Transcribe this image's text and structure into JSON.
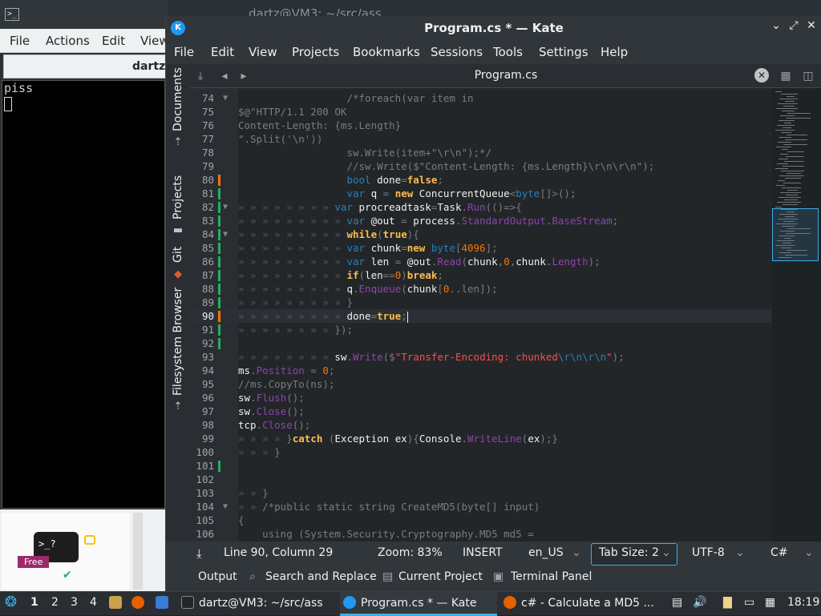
{
  "terminal": {
    "title": "dartz@VM3: ~/src/ass",
    "menu": [
      "File",
      "Actions",
      "Edit",
      "View"
    ],
    "tab_label": "dartz",
    "output": "piss",
    "thumb_prompt": ">_?",
    "thumb_badge": "Free"
  },
  "kate": {
    "title": "Program.cs * — Kate",
    "menu": [
      "File",
      "Edit",
      "View",
      "Projects",
      "Bookmarks",
      "Sessions",
      "Tools",
      "Settings",
      "Help"
    ],
    "sidebar_tabs": [
      "Documents",
      "Projects",
      "Git",
      "Filesystem Browser"
    ],
    "tab_name": "Program.cs",
    "lines": [
      {
        "n": "74",
        "fold": "v",
        "code": [
          [
            "ws",
            "                  "
          ],
          [
            "c",
            "/*foreach(var item in"
          ]
        ]
      },
      {
        "n": "75",
        "code": [
          [
            "c",
            "$@\"HTTP/1.1 200 OK"
          ]
        ]
      },
      {
        "n": "76",
        "code": [
          [
            "c",
            "Content-Length: {ms.Length}"
          ]
        ]
      },
      {
        "n": "77",
        "code": [
          [
            "c",
            "\".Split('\\n'))"
          ]
        ]
      },
      {
        "n": "78",
        "code": [
          [
            "ws",
            "                  "
          ],
          [
            "c",
            "sw.Write(item+\"\\r\\n\");*/"
          ]
        ]
      },
      {
        "n": "79",
        "code": [
          [
            "ws",
            "                  "
          ],
          [
            "c",
            "//sw.Write($\"Content-Length: {ms.Length}\\r\\n\\r\\n\");"
          ]
        ]
      },
      {
        "n": "80",
        "mark": "#f67400",
        "code": [
          [
            "ws",
            "                  "
          ],
          [
            "t",
            "bool"
          ],
          [
            "p",
            " done"
          ],
          [
            "c",
            "="
          ],
          [
            "k",
            "false"
          ],
          [
            "c",
            ";"
          ]
        ]
      },
      {
        "n": "81",
        "mark": "#27ae60",
        "code": [
          [
            "ws",
            "                  "
          ],
          [
            "t",
            "var"
          ],
          [
            "p",
            " q "
          ],
          [
            "c",
            "="
          ],
          [
            "p",
            " "
          ],
          [
            "k",
            "new"
          ],
          [
            "p",
            " ConcurrentQueue"
          ],
          [
            "c",
            "<"
          ],
          [
            "t",
            "byte"
          ],
          [
            "c",
            "[]>();"
          ]
        ]
      },
      {
        "n": "82",
        "fold": "v",
        "mark": "#27ae60",
        "code": [
          [
            "ws",
            "» » » » » » » » "
          ],
          [
            "t",
            "var"
          ],
          [
            "p",
            " procreadtask"
          ],
          [
            "c",
            "="
          ],
          [
            "p",
            "Task"
          ],
          [
            "c",
            "."
          ],
          [
            "f",
            "Run"
          ],
          [
            "c",
            "(()=>{"
          ]
        ]
      },
      {
        "n": "83",
        "mark": "#27ae60",
        "code": [
          [
            "ws",
            "» » » » » » » » » "
          ],
          [
            "t",
            "var"
          ],
          [
            "p",
            " @out "
          ],
          [
            "c",
            "="
          ],
          [
            "p",
            " process"
          ],
          [
            "c",
            "."
          ],
          [
            "f",
            "StandardOutput"
          ],
          [
            "c",
            "."
          ],
          [
            "f",
            "BaseStream"
          ],
          [
            "c",
            ";"
          ]
        ]
      },
      {
        "n": "84",
        "fold": "v",
        "mark": "#27ae60",
        "code": [
          [
            "ws",
            "» » » » » » » » » "
          ],
          [
            "k",
            "while"
          ],
          [
            "c",
            "("
          ],
          [
            "k",
            "true"
          ],
          [
            "c",
            "){"
          ]
        ]
      },
      {
        "n": "85",
        "mark": "#27ae60",
        "code": [
          [
            "ws",
            "» » » » » » » » » "
          ],
          [
            "t",
            "var"
          ],
          [
            "p",
            " chunk"
          ],
          [
            "c",
            "="
          ],
          [
            "k",
            "new"
          ],
          [
            "p",
            " "
          ],
          [
            "t",
            "byte"
          ],
          [
            "c",
            "["
          ],
          [
            "n",
            "4096"
          ],
          [
            "c",
            "];"
          ]
        ]
      },
      {
        "n": "86",
        "mark": "#27ae60",
        "code": [
          [
            "ws",
            "» » » » » » » » » "
          ],
          [
            "t",
            "var"
          ],
          [
            "p",
            " len "
          ],
          [
            "c",
            "="
          ],
          [
            "p",
            " @out"
          ],
          [
            "c",
            "."
          ],
          [
            "f",
            "Read"
          ],
          [
            "c",
            "("
          ],
          [
            "p",
            "chunk"
          ],
          [
            "c",
            ","
          ],
          [
            "n",
            "0"
          ],
          [
            "c",
            ","
          ],
          [
            "p",
            "chunk"
          ],
          [
            "c",
            "."
          ],
          [
            "f",
            "Length"
          ],
          [
            "c",
            ");"
          ]
        ]
      },
      {
        "n": "87",
        "mark": "#27ae60",
        "code": [
          [
            "ws",
            "» » » » » » » » » "
          ],
          [
            "k",
            "if"
          ],
          [
            "c",
            "("
          ],
          [
            "p",
            "len"
          ],
          [
            "c",
            "=="
          ],
          [
            "n",
            "0"
          ],
          [
            "c",
            ")"
          ],
          [
            "k",
            "break"
          ],
          [
            "c",
            ";"
          ]
        ]
      },
      {
        "n": "88",
        "mark": "#27ae60",
        "code": [
          [
            "ws",
            "» » » » » » » » » "
          ],
          [
            "p",
            "q"
          ],
          [
            "c",
            "."
          ],
          [
            "f",
            "Enqueue"
          ],
          [
            "c",
            "("
          ],
          [
            "p",
            "chunk"
          ],
          [
            "c",
            "["
          ],
          [
            "n",
            "0"
          ],
          [
            "c",
            "..len]);"
          ]
        ]
      },
      {
        "n": "89",
        "mark": "#27ae60",
        "code": [
          [
            "ws",
            "» » » » » » » » » "
          ],
          [
            "c",
            "}"
          ]
        ]
      },
      {
        "n": "90",
        "mark": "#f67400",
        "cur": true,
        "code": [
          [
            "ws",
            "» » » » » » » » » "
          ],
          [
            "p",
            "done"
          ],
          [
            "c",
            "="
          ],
          [
            "k",
            "true"
          ],
          [
            "c",
            ";"
          ]
        ]
      },
      {
        "n": "91",
        "mark": "#27ae60",
        "code": [
          [
            "ws",
            "» » » » » » » » "
          ],
          [
            "c",
            "});"
          ]
        ]
      },
      {
        "n": "92",
        "mark": "#27ae60",
        "code": []
      },
      {
        "n": "93",
        "code": [
          [
            "ws",
            "» » » » » » » » "
          ],
          [
            "p",
            "sw"
          ],
          [
            "c",
            "."
          ],
          [
            "f",
            "Write"
          ],
          [
            "c",
            "($"
          ],
          [
            "s",
            "\"Transfer-Encoding: chunked"
          ],
          [
            "t",
            "\\r\\n\\r\\n"
          ],
          [
            "s",
            "\""
          ],
          [
            "c",
            ");"
          ]
        ]
      },
      {
        "n": "94",
        "code": [
          [
            "p",
            "ms"
          ],
          [
            "c",
            "."
          ],
          [
            "f",
            "Position"
          ],
          [
            "c",
            " = "
          ],
          [
            "n",
            "0"
          ],
          [
            "c",
            ";"
          ]
        ]
      },
      {
        "n": "95",
        "code": [
          [
            "c",
            "//ms.CopyTo(ns);"
          ]
        ]
      },
      {
        "n": "96",
        "code": [
          [
            "p",
            "sw"
          ],
          [
            "c",
            "."
          ],
          [
            "f",
            "Flush"
          ],
          [
            "c",
            "();"
          ]
        ]
      },
      {
        "n": "97",
        "code": [
          [
            "p",
            "sw"
          ],
          [
            "c",
            "."
          ],
          [
            "f",
            "Close"
          ],
          [
            "c",
            "();"
          ]
        ]
      },
      {
        "n": "98",
        "code": [
          [
            "p",
            "tcp"
          ],
          [
            "c",
            "."
          ],
          [
            "f",
            "Close"
          ],
          [
            "c",
            "();"
          ]
        ]
      },
      {
        "n": "99",
        "code": [
          [
            "ws",
            "» » » » "
          ],
          [
            "c",
            "}"
          ],
          [
            "k",
            "catch"
          ],
          [
            "p",
            " "
          ],
          [
            "c",
            "("
          ],
          [
            "p",
            "Exception ex"
          ],
          [
            "c",
            "){"
          ],
          [
            "p",
            "Console"
          ],
          [
            "c",
            "."
          ],
          [
            "f",
            "WriteLine"
          ],
          [
            "c",
            "("
          ],
          [
            "p",
            "ex"
          ],
          [
            "c",
            ");}"
          ]
        ]
      },
      {
        "n": "100",
        "code": [
          [
            "ws",
            "» » » "
          ],
          [
            "c",
            "}"
          ]
        ]
      },
      {
        "n": "101",
        "mark": "#27ae60",
        "code": []
      },
      {
        "n": "102",
        "code": []
      },
      {
        "n": "103",
        "code": [
          [
            "ws",
            "» » "
          ],
          [
            "c",
            "}"
          ]
        ]
      },
      {
        "n": "104",
        "fold": "v",
        "code": [
          [
            "ws",
            "» » "
          ],
          [
            "c",
            "/*public static string CreateMD5(byte[] input)"
          ]
        ]
      },
      {
        "n": "105",
        "code": [
          [
            "c",
            "{"
          ]
        ]
      },
      {
        "n": "106",
        "code": [
          [
            "c",
            "    using (System.Security.Cryptography.MD5 md5 ="
          ]
        ]
      }
    ],
    "status": {
      "position": "Line 90, Column 29",
      "zoom": "Zoom: 83%",
      "mode": "INSERT",
      "lang": "en_US",
      "tabsize": "Tab Size: 2",
      "encoding": "UTF-8",
      "syntax": "C#"
    },
    "bottom": [
      "Output",
      "Search and Replace",
      "Current Project",
      "Terminal Panel"
    ]
  },
  "taskbar": {
    "desktops": [
      "1",
      "2",
      "3",
      "4"
    ],
    "task_terminal": "dartz@VM3: ~/src/ass",
    "task_kate": "Program.cs * — Kate",
    "task_firefox": "c# - Calculate a MD5 ...",
    "clock": "18:19"
  }
}
